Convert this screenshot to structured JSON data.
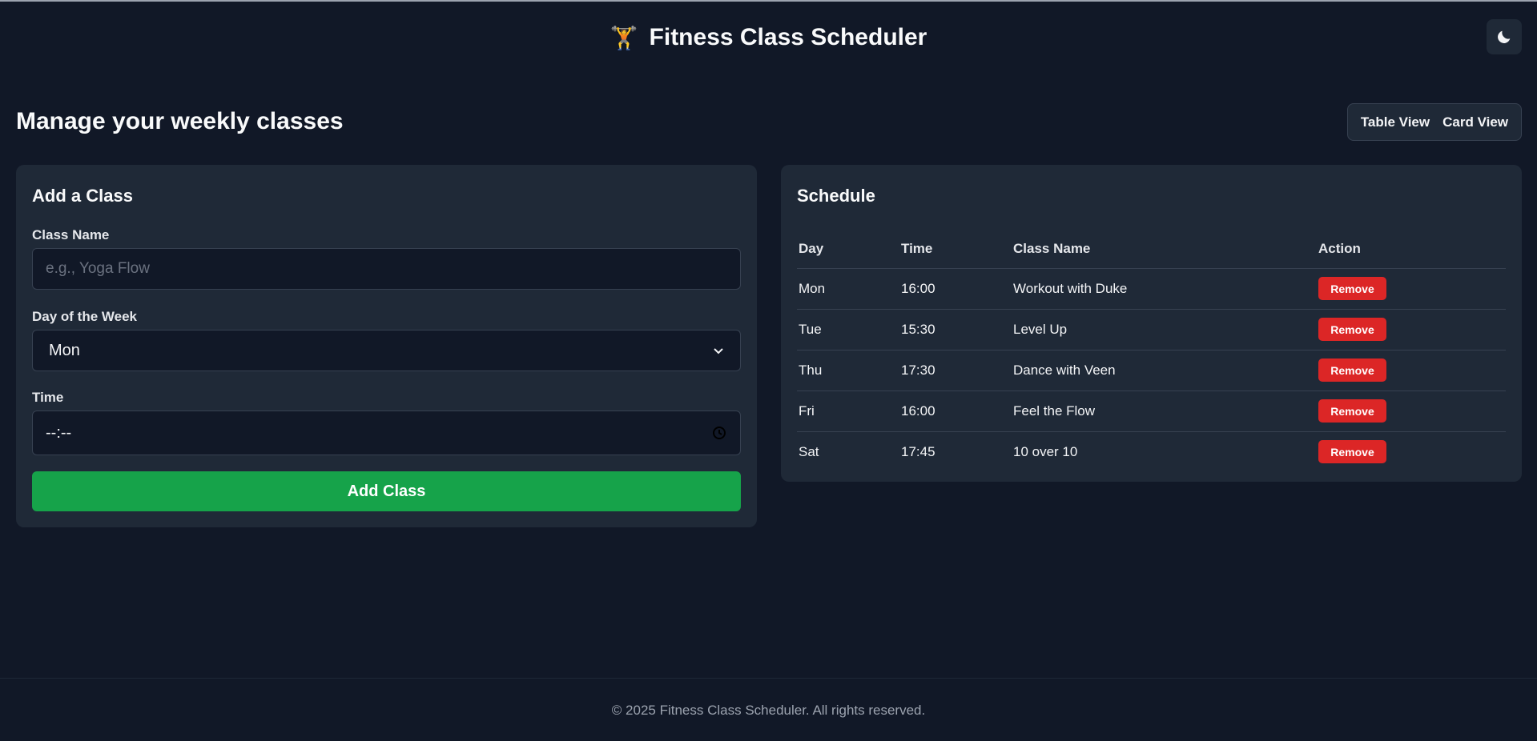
{
  "header": {
    "icon": "weightlifter-icon",
    "title": "Fitness Class Scheduler",
    "theme_toggle_icon": "moon-icon"
  },
  "page": {
    "heading": "Manage your weekly classes"
  },
  "view_toggle": {
    "table_label": "Table View",
    "card_label": "Card View"
  },
  "add_form": {
    "title": "Add a Class",
    "class_name_label": "Class Name",
    "class_name_placeholder": "e.g., Yoga Flow",
    "class_name_value": "",
    "day_label": "Day of the Week",
    "day_value": "Mon",
    "time_label": "Time",
    "time_value": "--:--",
    "submit_label": "Add Class"
  },
  "schedule": {
    "title": "Schedule",
    "columns": [
      "Day",
      "Time",
      "Class Name",
      "Action"
    ],
    "remove_label": "Remove",
    "rows": [
      {
        "day": "Mon",
        "time": "16:00",
        "name": "Workout with Duke"
      },
      {
        "day": "Tue",
        "time": "15:30",
        "name": "Level Up"
      },
      {
        "day": "Thu",
        "time": "17:30",
        "name": "Dance with Veen"
      },
      {
        "day": "Fri",
        "time": "16:00",
        "name": "Feel the Flow"
      },
      {
        "day": "Sat",
        "time": "17:45",
        "name": "10 over 10"
      }
    ]
  },
  "footer": {
    "text": "© 2025 Fitness Class Scheduler. All rights reserved."
  },
  "colors": {
    "background": "#111827",
    "panel": "#1f2937",
    "accent_green": "#16a34a",
    "danger_red": "#dc2626"
  }
}
